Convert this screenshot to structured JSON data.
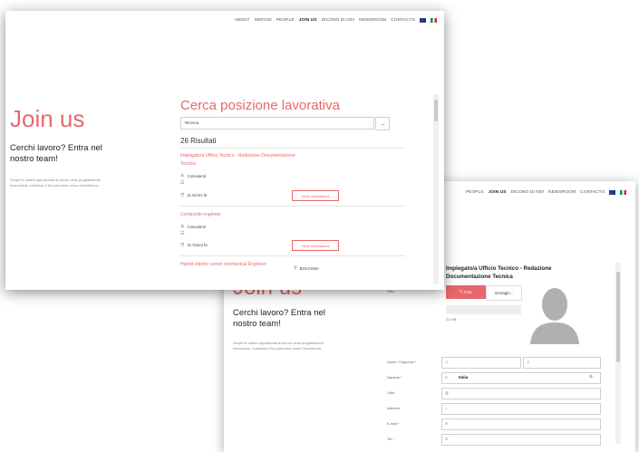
{
  "nav": {
    "items": [
      "ABOUT",
      "SERVIZI",
      "PEOPLE",
      "JOIN US",
      "DICONO DI NOI",
      "NEWSROOM",
      "CONTACTS"
    ],
    "active": "JOIN US",
    "back_items": [
      "PEOPLE",
      "JOIN US",
      "DICONO DI NOI",
      "NEWSROOM",
      "CONTACTS"
    ]
  },
  "left": {
    "title": "Join us",
    "heading": "Cerchi lavoro? Entra nel nostro team!",
    "paragraph": "Scopri le nostre opportunità di lavoro nella progettazione meccanica, costruisci il tuo percorso verso l'eccellenza."
  },
  "search": {
    "heading": "Cerca posizione lavorativa",
    "placeholder": "Ricerca",
    "results": "26 Risultati"
  },
  "jobs": [
    {
      "title": "Impiegato/a Ufficio Tecnico - Redazione Documentazione Tecnica",
      "type": "Consulenti",
      "age": "11 Giorni fa",
      "button": "Invia candidatura"
    },
    {
      "title": "Composite engineer",
      "type": "Consulenti",
      "age": "21 Giorni fa",
      "button": "Invia candidatura"
    },
    {
      "title": "Hybrid electric senior mechanical Engineer",
      "location": "BOLOGNA"
    }
  ],
  "form": {
    "job_title": "Impiegato/a Ufficio Tecnico - Redazione Documentazione Tecnica",
    "photo_label": "Foto",
    "photo_button": "Foto",
    "image_button": "Immagin...",
    "size_text": "2.0 KB",
    "fields": [
      {
        "label": "Nome / Cognome *"
      },
      {
        "label": "Nazione *",
        "value": "Italia"
      },
      {
        "label": "Città"
      },
      {
        "label": "Indirizzo"
      },
      {
        "label": "E-mail *"
      },
      {
        "label": "Tel. *"
      }
    ]
  },
  "colors": {
    "accent": "#e8686b",
    "text": "#222222",
    "muted": "#888888"
  }
}
